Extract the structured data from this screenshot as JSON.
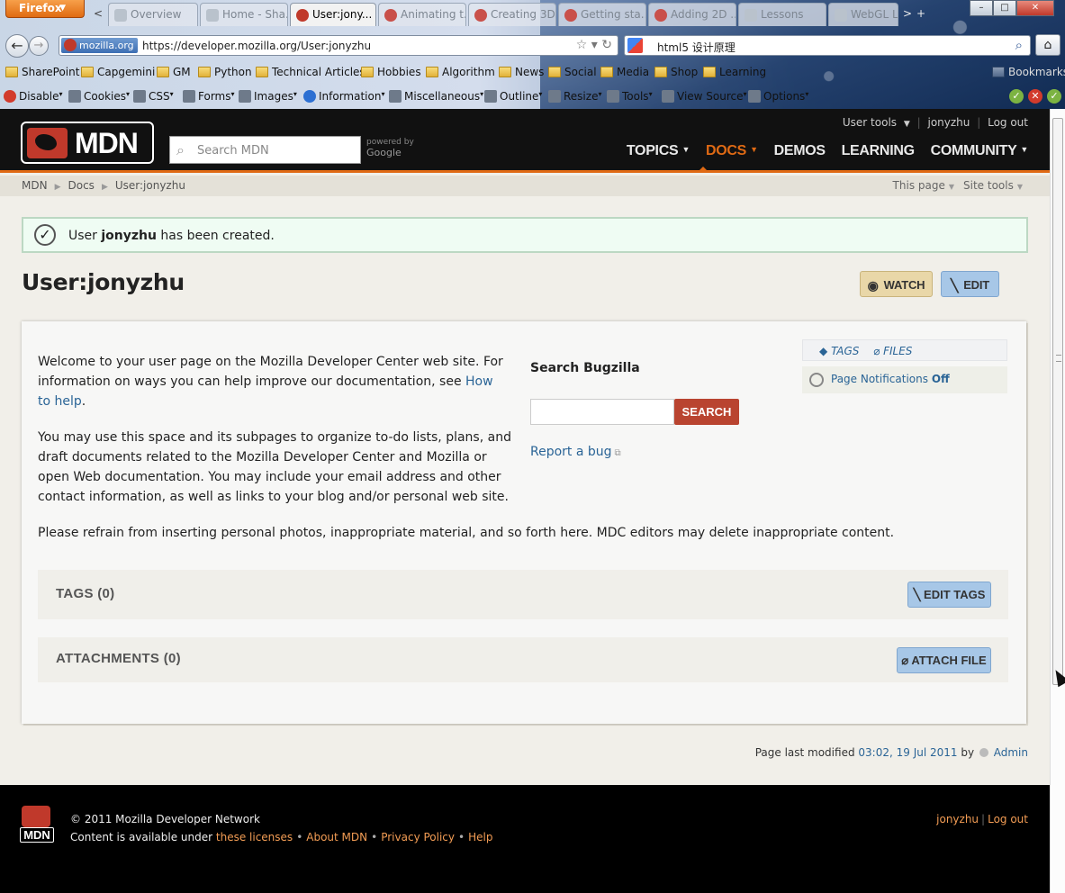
{
  "browser": {
    "menu_button": "Firefox",
    "tabs": [
      {
        "label": "Overview"
      },
      {
        "label": "Home - Sha..."
      },
      {
        "label": "User:jony..."
      },
      {
        "label": "Animating t..."
      },
      {
        "label": "Creating 3D..."
      },
      {
        "label": "Getting sta..."
      },
      {
        "label": "Adding 2D ..."
      },
      {
        "label": "Lessons"
      },
      {
        "label": "WebGL L..."
      }
    ],
    "identity": "mozilla.org",
    "url": "https://developer.mozilla.org/User:jonyzhu",
    "search_text": "html5 设计原理",
    "bookmarks": [
      "SharePoint",
      "Capgemini",
      "GM",
      "Python",
      "Technical Articles",
      "Hobbies",
      "Algorithm",
      "News",
      "Social",
      "Media",
      "Shop",
      "Learning"
    ],
    "bookmarks_menu": "Bookmarks",
    "devtools": [
      "Disable",
      "Cookies",
      "CSS",
      "Forms",
      "Images",
      "Information",
      "Miscellaneous",
      "Outline",
      "Resize",
      "Tools",
      "View Source",
      "Options"
    ]
  },
  "mdn": {
    "logo_text": "MDN",
    "search_placeholder": "Search MDN",
    "powered_by": "powered by",
    "google": "Google",
    "user_tools": "User tools",
    "username": "jonyzhu",
    "logout": "Log out",
    "nav": [
      "TOPICS",
      "DOCS",
      "DEMOS",
      "LEARNING",
      "COMMUNITY"
    ],
    "breadcrumbs": [
      "MDN",
      "Docs",
      "User:jonyzhu"
    ],
    "this_page": "This page",
    "site_tools": "Site tools"
  },
  "notice": {
    "prefix": "User",
    "user": "jonyzhu",
    "suffix": "has been created."
  },
  "page": {
    "title": "User:jonyzhu",
    "watch": "WATCH",
    "edit": "EDIT",
    "para1_a": "Welcome to your user page on the Mozilla Developer Center web site. For information on ways you can help improve our documentation, see",
    "para1_link": "How to help",
    "para1_b": ".",
    "para2": "You may use this space and its subpages to organize to-do lists, plans, and draft documents related to the Mozilla Developer Center and Mozilla or open Web documentation.  You may include your email address and other contact information, as well as links to your blog and/or personal web site.",
    "para3": "Please refrain from inserting personal photos, inappropriate material, and so forth here.  MDC editors may delete inappropriate content.",
    "bugzilla_title": "Search Bugzilla",
    "bugzilla_button": "SEARCH",
    "report_bug": "Report a bug",
    "side_tags": "TAGS",
    "side_files": "FILES",
    "notifications_label": "Page Notifications",
    "notifications_state": "Off",
    "tags_section": "TAGS (0)",
    "edit_tags": "EDIT TAGS",
    "attachments_section": "ATTACHMENTS (0)",
    "attach_file": "ATTACH FILE",
    "modified_prefix": "Page last modified",
    "modified_time": "03:02, 19 Jul 2011",
    "modified_by": "by",
    "modified_user": "Admin"
  },
  "footer": {
    "logo_text": "MDN",
    "copyright": "© 2011 Mozilla Developer Network",
    "license_prefix": "Content is available under",
    "licenses": "these licenses",
    "about": "About MDN",
    "privacy": "Privacy Policy",
    "help": "Help",
    "user": "jonyzhu",
    "logout": "Log out"
  }
}
